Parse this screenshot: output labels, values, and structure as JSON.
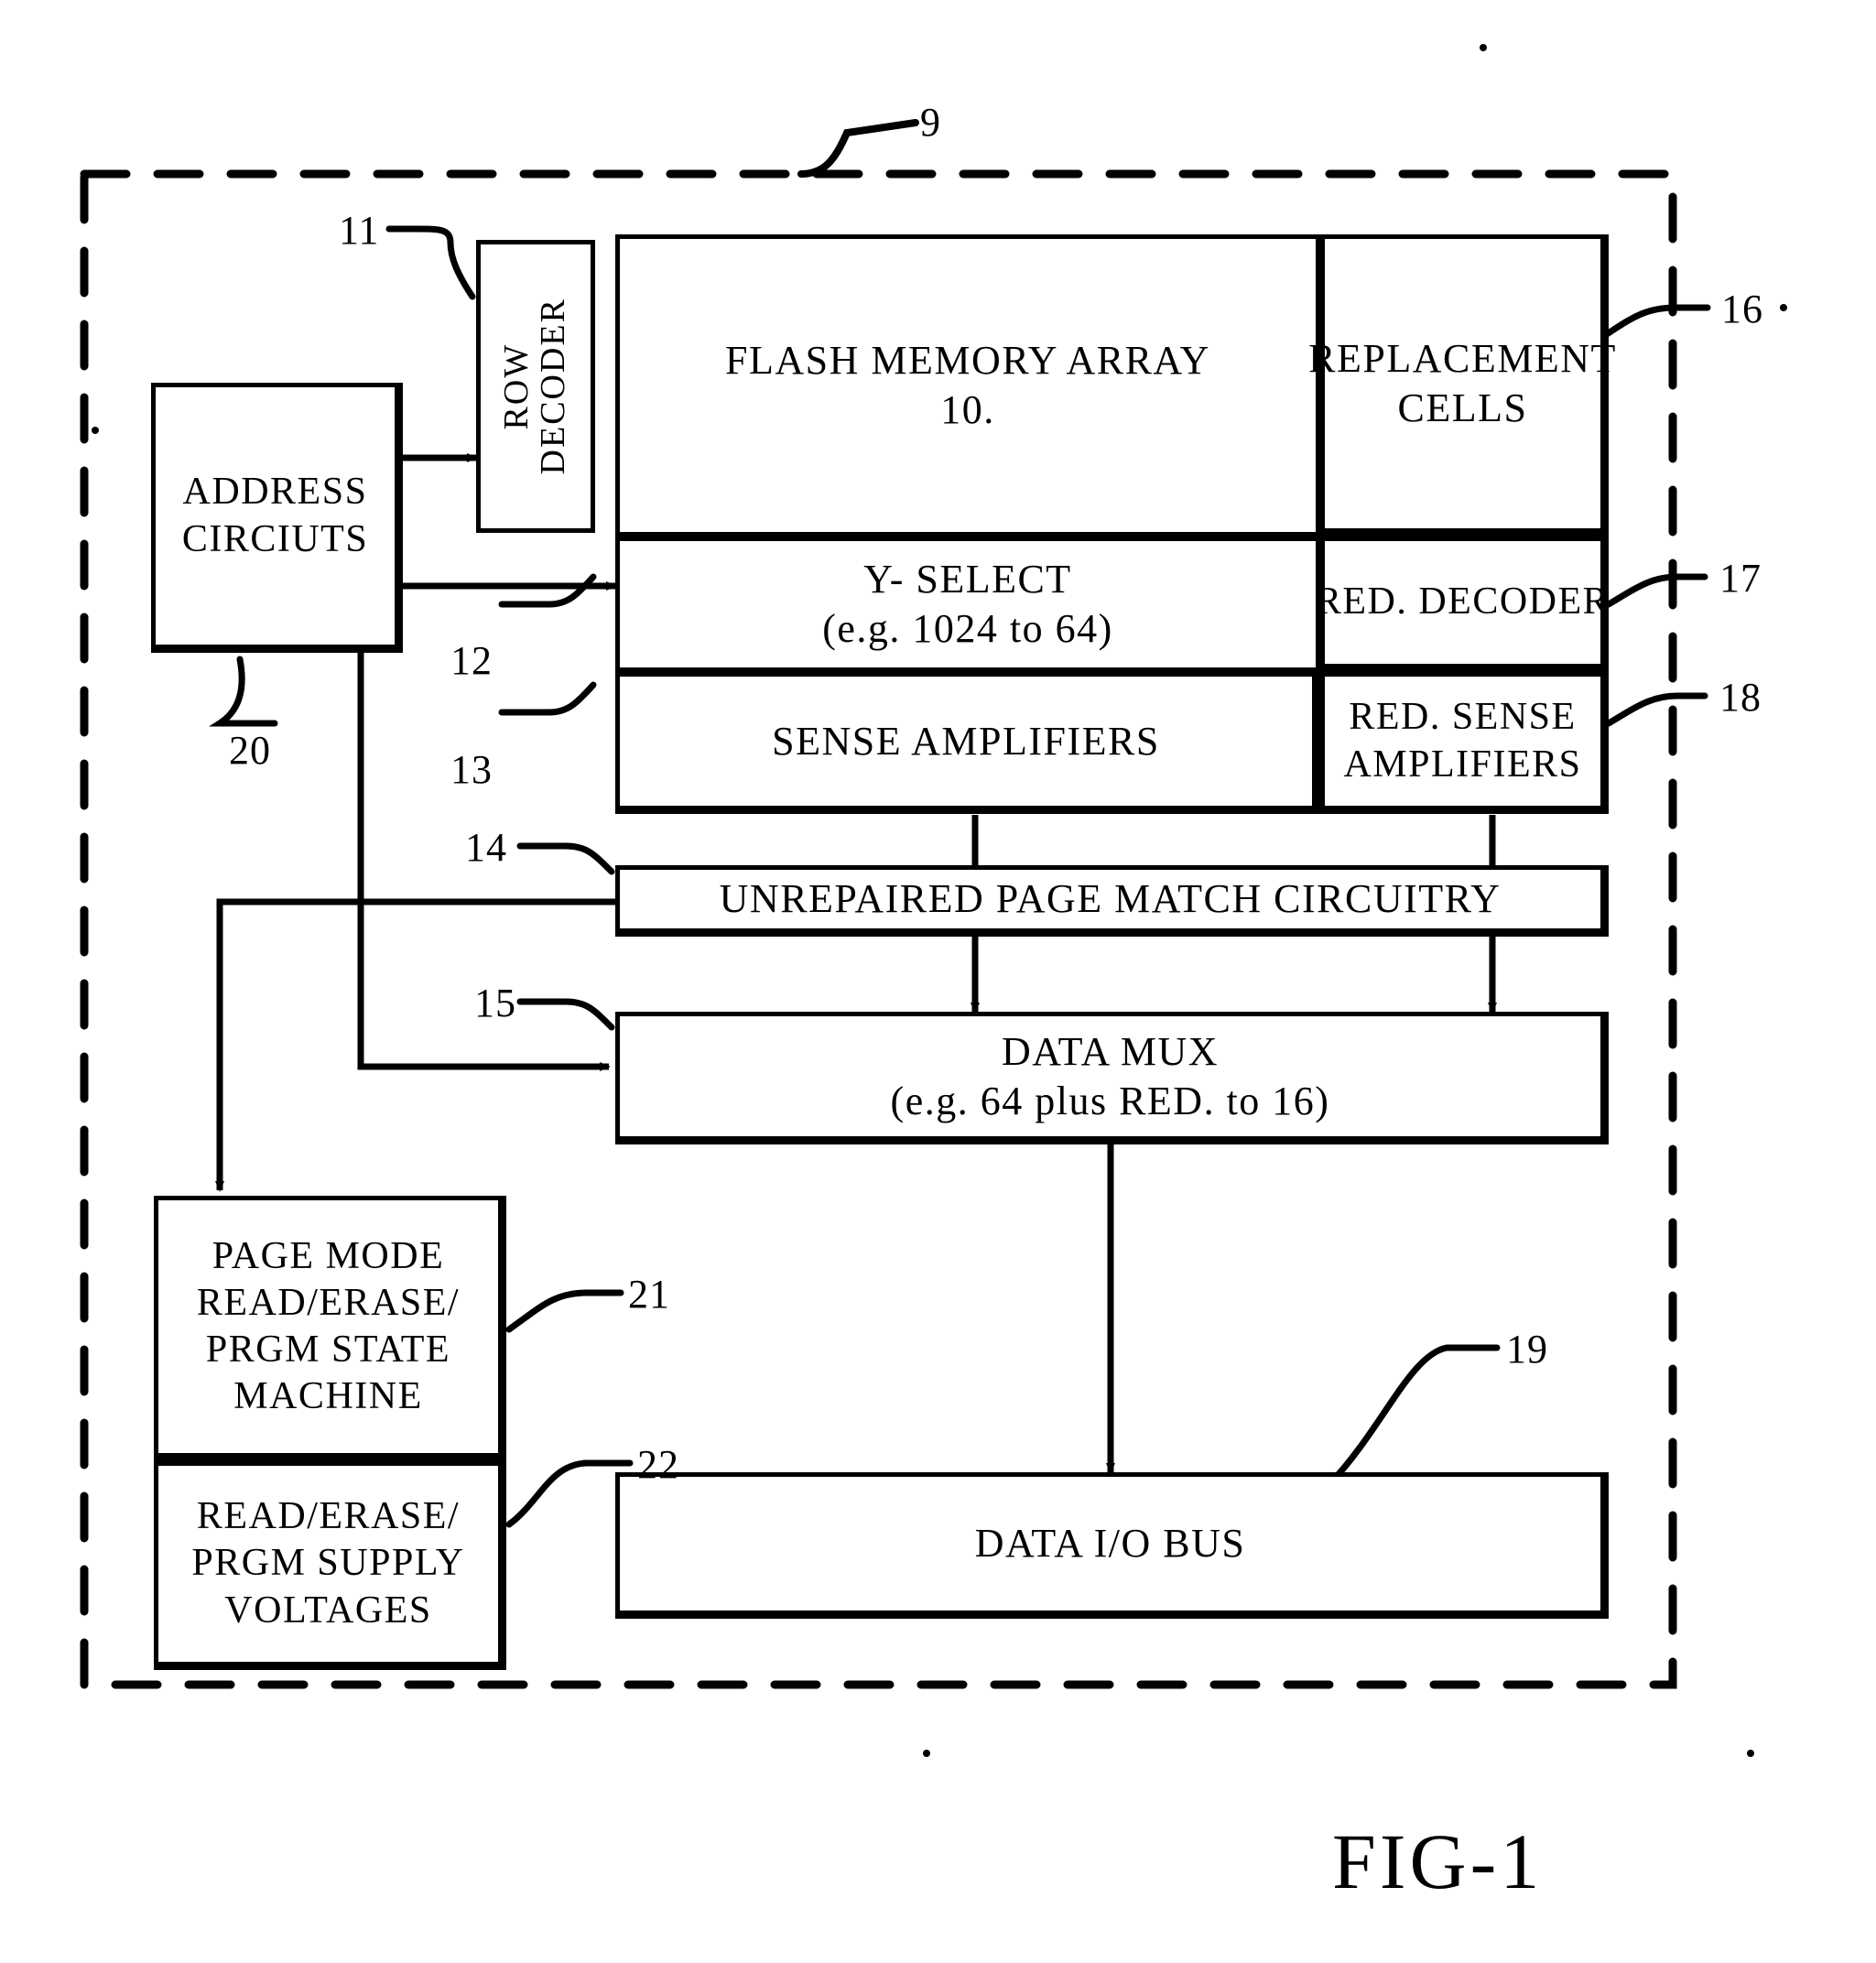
{
  "figure": {
    "label": "FIG-1",
    "chip_boundary_ref": "9"
  },
  "blocks": {
    "address_circuits": {
      "ref": "20",
      "lines": [
        "ADDRESS",
        "CIRCIUTS"
      ]
    },
    "row_decoder": {
      "ref": "11",
      "lines": [
        "ROW",
        "DECODER"
      ]
    },
    "flash_memory_array": {
      "lines": [
        "FLASH MEMORY ARRAY",
        "10."
      ]
    },
    "replacement_cells": {
      "ref": "16",
      "lines": [
        "REPLACEMENT",
        "CELLS"
      ]
    },
    "y_select": {
      "ref": "12",
      "lines": [
        "Y- SELECT",
        "(e.g. 1024 to 64)"
      ]
    },
    "red_decoder": {
      "ref": "17",
      "lines": [
        "RED. DECODER"
      ]
    },
    "sense_amplifiers": {
      "ref": "13",
      "lines": [
        "SENSE AMPLIFIERS"
      ]
    },
    "red_sense_amplifiers": {
      "ref": "18",
      "lines": [
        "RED. SENSE",
        "AMPLIFIERS"
      ]
    },
    "unrepaired_page_match": {
      "ref": "14",
      "lines": [
        "UNREPAIRED PAGE MATCH CIRCUITRY"
      ]
    },
    "data_mux": {
      "ref": "15",
      "lines": [
        "DATA MUX",
        "(e.g. 64 plus RED. to 16)"
      ]
    },
    "page_mode_state_machine": {
      "ref": "21",
      "lines": [
        "PAGE MODE",
        "READ/ERASE/",
        "PRGM STATE",
        "MACHINE"
      ]
    },
    "supply_voltages": {
      "ref": "22",
      "lines": [
        "READ/ERASE/",
        "PRGM SUPPLY",
        "VOLTAGES"
      ]
    },
    "data_io_bus": {
      "ref": "19",
      "lines": [
        "DATA I/O BUS"
      ]
    }
  },
  "colors": {
    "ink": "#000000",
    "paper": "#ffffff"
  }
}
